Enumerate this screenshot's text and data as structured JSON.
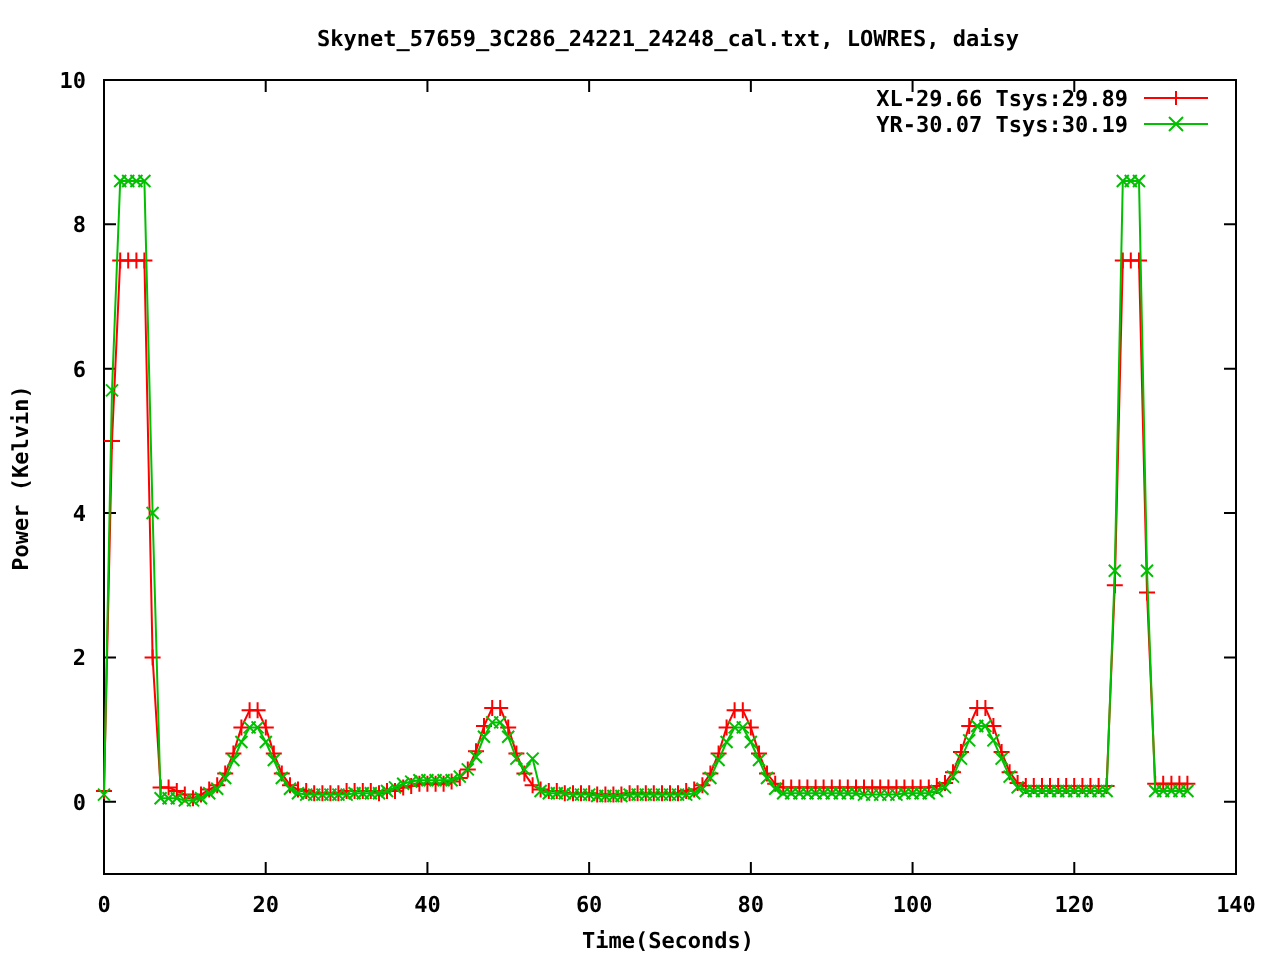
{
  "chart_data": {
    "type": "line",
    "title": "Skynet_57659_3C286_24221_24248_cal.txt, LOWRES, daisy",
    "xlabel": "Time(Seconds)",
    "ylabel": "Power (Kelvin)",
    "legend": true,
    "xlim": [
      0,
      140
    ],
    "ylim": [
      -1,
      10
    ],
    "xticks": [
      0,
      20,
      40,
      60,
      80,
      100,
      120,
      140
    ],
    "yticks": [
      0,
      2,
      4,
      6,
      8,
      10
    ],
    "x": [
      0,
      1,
      2,
      3,
      4,
      5,
      6,
      7,
      8,
      9,
      10,
      11,
      12,
      13,
      14,
      15,
      16,
      17,
      18,
      19,
      20,
      21,
      22,
      23,
      24,
      25,
      26,
      27,
      28,
      29,
      30,
      31,
      32,
      33,
      34,
      35,
      36,
      37,
      38,
      39,
      40,
      41,
      42,
      43,
      44,
      45,
      46,
      47,
      48,
      49,
      50,
      51,
      52,
      53,
      54,
      55,
      56,
      57,
      58,
      59,
      60,
      61,
      62,
      63,
      64,
      65,
      66,
      67,
      68,
      69,
      70,
      71,
      72,
      73,
      74,
      75,
      76,
      77,
      78,
      79,
      80,
      81,
      82,
      83,
      84,
      85,
      86,
      87,
      88,
      89,
      90,
      91,
      92,
      93,
      94,
      95,
      96,
      97,
      98,
      99,
      100,
      101,
      102,
      103,
      104,
      105,
      106,
      107,
      108,
      109,
      110,
      111,
      112,
      113,
      114,
      115,
      116,
      117,
      118,
      119,
      120,
      121,
      122,
      123,
      124,
      125,
      126,
      127,
      128,
      129,
      130,
      131,
      132,
      133,
      134
    ],
    "series": [
      {
        "name": "XL-29.66 Tsys:29.89",
        "color": "#ff0000",
        "marker": "plus",
        "values": [
          0.15,
          5.0,
          7.5,
          7.5,
          7.5,
          7.5,
          2.0,
          0.2,
          0.2,
          0.15,
          0.1,
          0.05,
          0.1,
          0.17,
          0.23,
          0.39,
          0.67,
          1.03,
          1.27,
          1.27,
          1.03,
          0.67,
          0.39,
          0.23,
          0.17,
          0.15,
          0.12,
          0.12,
          0.12,
          0.12,
          0.15,
          0.15,
          0.15,
          0.15,
          0.12,
          0.15,
          0.15,
          0.2,
          0.22,
          0.25,
          0.25,
          0.25,
          0.25,
          0.28,
          0.33,
          0.45,
          0.7,
          1.05,
          1.3,
          1.3,
          1.03,
          0.67,
          0.39,
          0.23,
          0.17,
          0.15,
          0.15,
          0.12,
          0.12,
          0.12,
          0.12,
          0.1,
          0.1,
          0.1,
          0.1,
          0.12,
          0.12,
          0.12,
          0.12,
          0.12,
          0.12,
          0.12,
          0.15,
          0.17,
          0.23,
          0.39,
          0.67,
          1.03,
          1.27,
          1.27,
          1.03,
          0.67,
          0.39,
          0.25,
          0.2,
          0.2,
          0.2,
          0.2,
          0.2,
          0.2,
          0.2,
          0.2,
          0.2,
          0.2,
          0.2,
          0.2,
          0.2,
          0.2,
          0.2,
          0.2,
          0.2,
          0.2,
          0.2,
          0.22,
          0.26,
          0.41,
          0.69,
          1.05,
          1.3,
          1.3,
          1.05,
          0.69,
          0.41,
          0.26,
          0.22,
          0.22,
          0.22,
          0.22,
          0.22,
          0.22,
          0.22,
          0.22,
          0.22,
          0.22,
          0.22,
          3.0,
          7.5,
          7.5,
          7.5,
          2.9,
          0.25,
          0.25,
          0.25,
          0.25,
          0.25
        ]
      },
      {
        "name": "YR-30.07 Tsys:30.19",
        "color": "#00c000",
        "marker": "cross",
        "values": [
          0.1,
          5.7,
          8.6,
          8.6,
          8.6,
          8.6,
          4.0,
          0.05,
          0.05,
          0.05,
          0.02,
          0.02,
          0.05,
          0.12,
          0.18,
          0.33,
          0.58,
          0.83,
          1.03,
          1.03,
          0.83,
          0.58,
          0.33,
          0.18,
          0.12,
          0.1,
          0.1,
          0.1,
          0.1,
          0.1,
          0.1,
          0.12,
          0.12,
          0.12,
          0.12,
          0.15,
          0.2,
          0.25,
          0.28,
          0.3,
          0.3,
          0.3,
          0.3,
          0.3,
          0.35,
          0.45,
          0.62,
          0.9,
          1.1,
          1.1,
          0.9,
          0.6,
          0.45,
          0.6,
          0.15,
          0.12,
          0.12,
          0.12,
          0.1,
          0.1,
          0.1,
          0.08,
          0.08,
          0.08,
          0.08,
          0.1,
          0.1,
          0.1,
          0.1,
          0.1,
          0.1,
          0.1,
          0.1,
          0.12,
          0.18,
          0.33,
          0.58,
          0.83,
          1.03,
          1.03,
          0.83,
          0.58,
          0.33,
          0.18,
          0.12,
          0.12,
          0.12,
          0.12,
          0.12,
          0.12,
          0.12,
          0.12,
          0.12,
          0.12,
          0.1,
          0.1,
          0.1,
          0.1,
          0.1,
          0.12,
          0.12,
          0.12,
          0.12,
          0.15,
          0.2,
          0.35,
          0.6,
          0.85,
          1.05,
          1.05,
          0.85,
          0.6,
          0.35,
          0.2,
          0.15,
          0.15,
          0.15,
          0.15,
          0.15,
          0.15,
          0.15,
          0.15,
          0.15,
          0.15,
          0.15,
          3.2,
          8.6,
          8.6,
          8.6,
          3.2,
          0.15,
          0.15,
          0.15,
          0.15,
          0.15
        ]
      }
    ]
  }
}
